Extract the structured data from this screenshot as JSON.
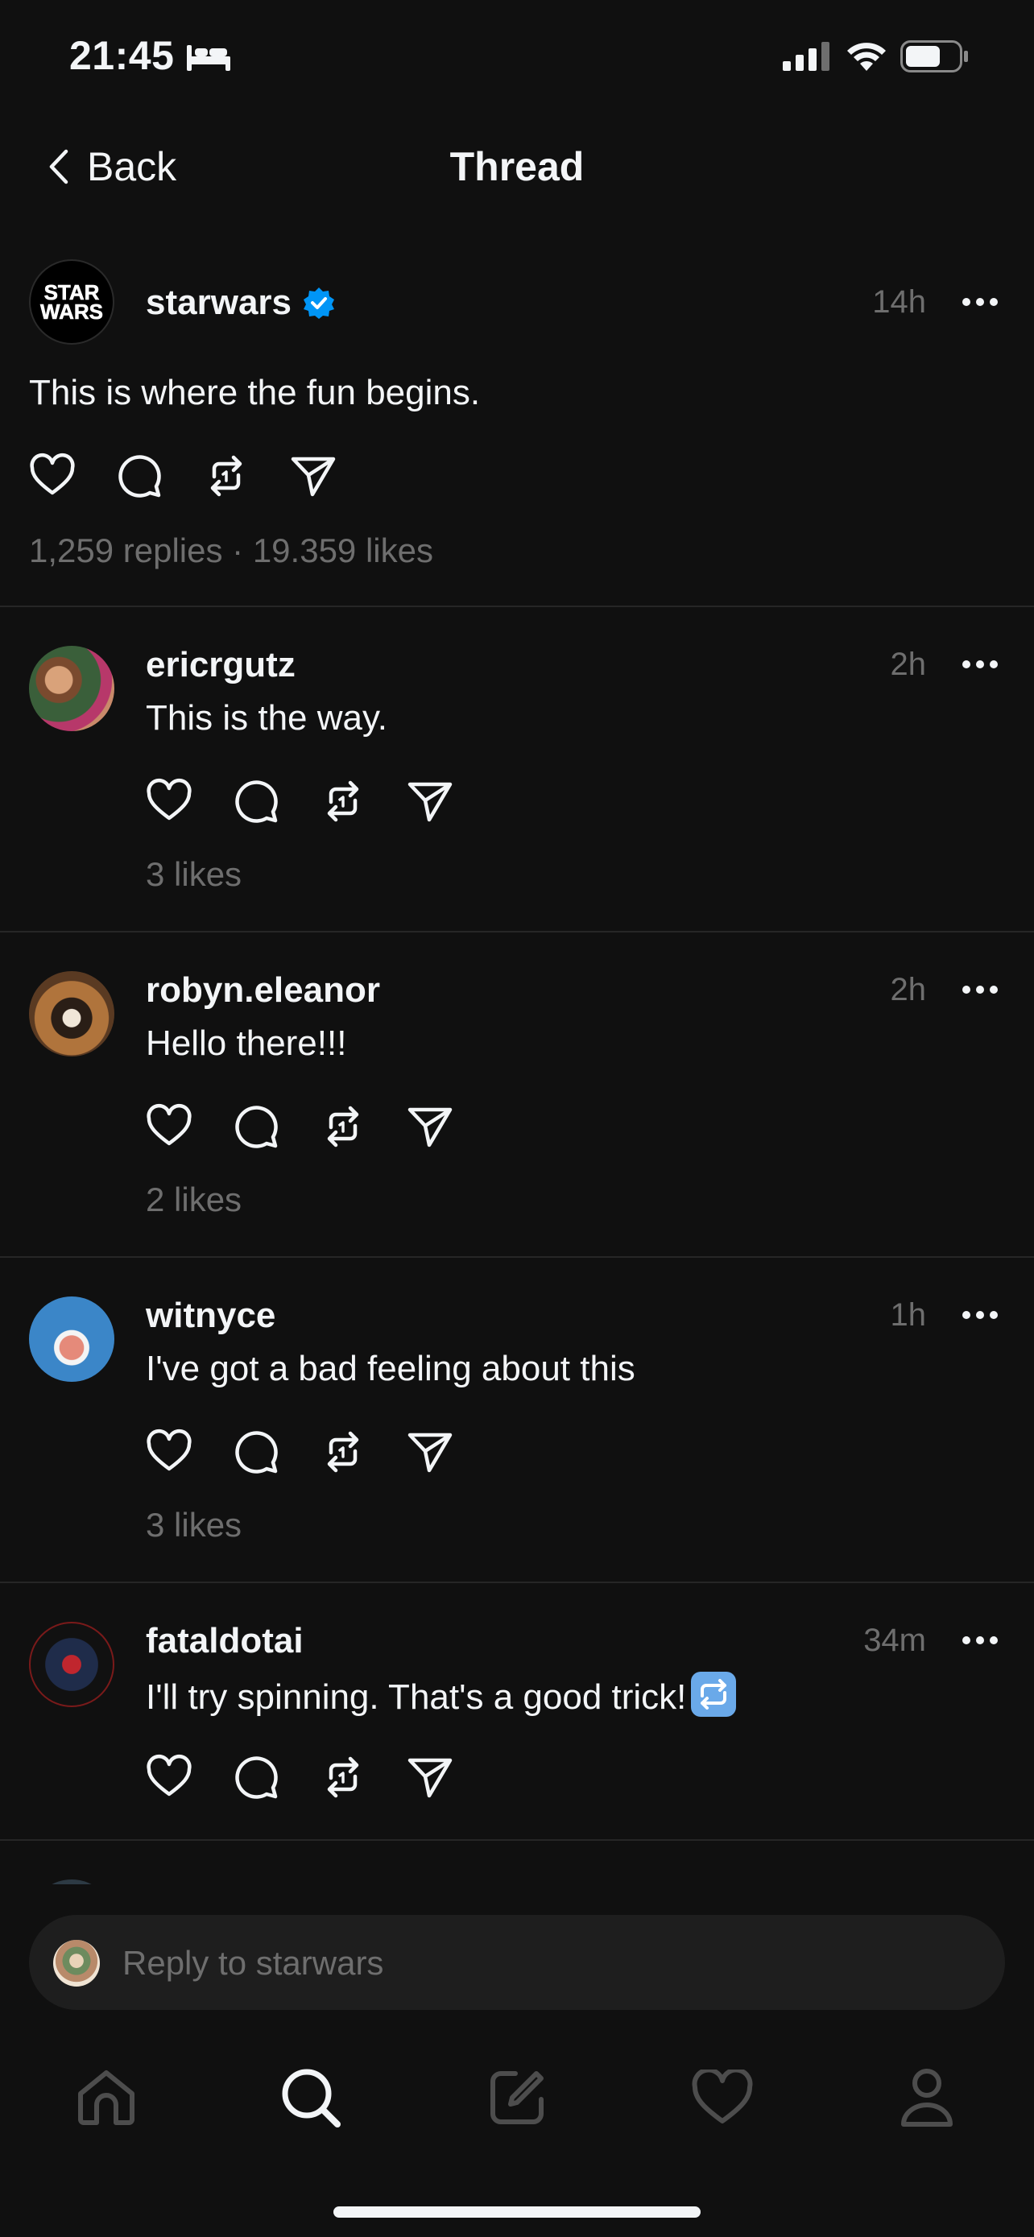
{
  "status_bar": {
    "time": "21:45"
  },
  "nav": {
    "back_label": "Back",
    "title": "Thread"
  },
  "original_post": {
    "username": "starwars",
    "verified": true,
    "time": "14h",
    "text": "This is where the fun begins.",
    "stats": "1,259 replies · 19.359 likes",
    "avatar_text": "STAR WARS"
  },
  "replies": [
    {
      "username": "ericrgutz",
      "time": "2h",
      "text": "This is the way.",
      "likes": "3 likes"
    },
    {
      "username": "robyn.eleanor",
      "time": "2h",
      "text": "Hello there!!!",
      "likes": "2 likes"
    },
    {
      "username": "witnyce",
      "time": "1h",
      "text": "I've got a bad feeling about this",
      "likes": "3 likes"
    },
    {
      "username": "fataldotai",
      "time": "34m",
      "text": "I'll try spinning. That's a good trick!",
      "likes": ""
    }
  ],
  "reply_bar": {
    "placeholder": "Reply to starwars"
  },
  "tabs": [
    "home-icon",
    "search-icon",
    "compose-icon",
    "heart-icon",
    "profile-icon"
  ],
  "colors": {
    "background": "#101010",
    "text": "#f3f5f7",
    "muted": "#6e6e6e",
    "verified": "#0095f6",
    "divider": "#262626"
  }
}
